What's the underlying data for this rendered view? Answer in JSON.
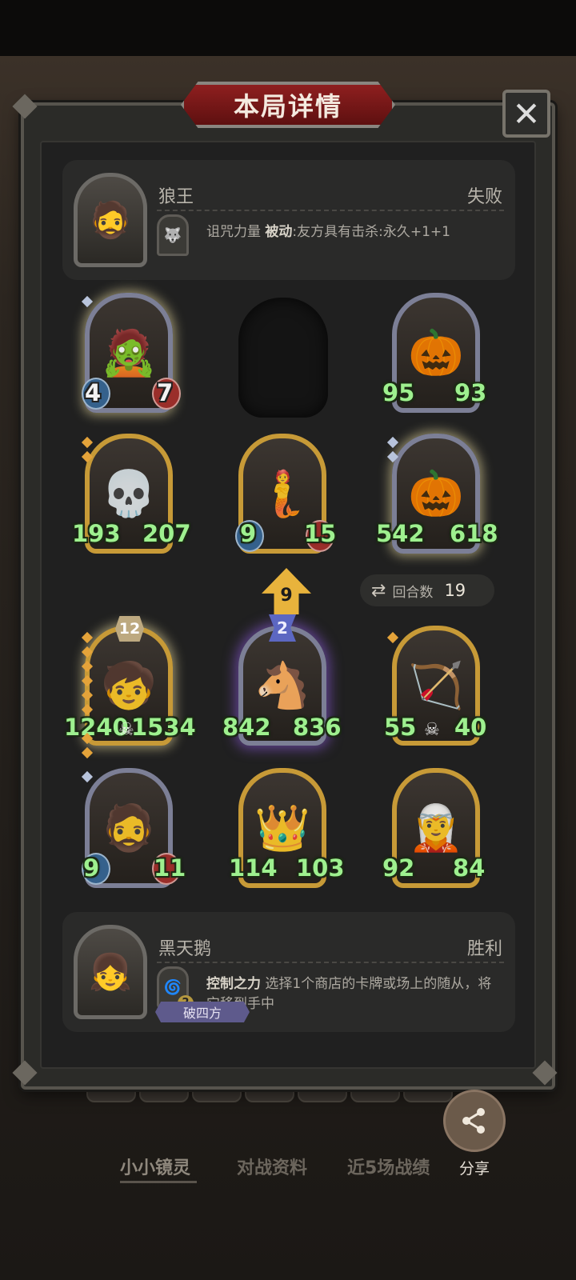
{
  "dialog": {
    "title": "本局详情",
    "close_icon": "close-icon"
  },
  "opponent": {
    "name": "狼王",
    "result": "失败",
    "skill_name": "诅咒力量",
    "skill_type": "被动",
    "skill_desc": ":友方具有击杀:永久+1+1"
  },
  "round": {
    "label": "回合数",
    "value": "19"
  },
  "tavern": {
    "level": "9",
    "tier": "2"
  },
  "board": [
    {
      "attack": "4",
      "health": "7"
    },
    {
      "empty": true
    },
    {
      "attack": "95",
      "health": "93"
    },
    {
      "attack": "193",
      "health": "207"
    },
    {
      "attack": "9",
      "health": "15"
    },
    {
      "attack": "542",
      "health": "618"
    },
    {
      "attack": "1240",
      "health": "1534",
      "gold_badge": "12"
    },
    {
      "attack": "842",
      "health": "836"
    },
    {
      "attack": "55",
      "health": "40"
    },
    {
      "attack": "9",
      "health": "11"
    },
    {
      "attack": "114",
      "health": "103"
    },
    {
      "attack": "92",
      "health": "84"
    }
  ],
  "player": {
    "name": "黑天鹅",
    "result": "胜利",
    "skill_name": "控制之力",
    "skill_desc": "选择1个商店的卡牌或场上的随从，将它移到手中",
    "skill_cost": "2",
    "tag": "破四方"
  },
  "bottom_tabs": [
    "小小镜灵",
    "对战资料",
    "近5场战绩"
  ],
  "share": {
    "label": "分享"
  },
  "colors": {
    "accent_red": "#8e1f1f",
    "stat_green": "#9ef08f",
    "gold_border": "#c79a37"
  }
}
